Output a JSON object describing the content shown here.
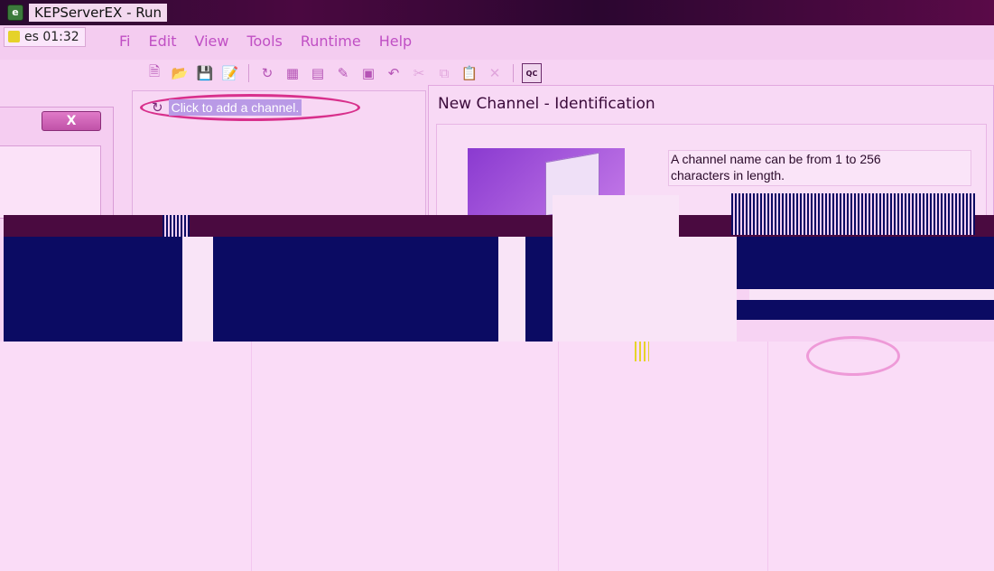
{
  "window": {
    "title": "KEPServerEX - Run",
    "status_time": "es 01:32"
  },
  "menu": {
    "items": [
      {
        "label": "Fi"
      },
      {
        "label": "Edit"
      },
      {
        "label": "View"
      },
      {
        "label": "Tools"
      },
      {
        "label": "Runtime"
      },
      {
        "label": "Help"
      }
    ]
  },
  "toolbar": {
    "buttons": [
      {
        "icon": "new-file-icon"
      },
      {
        "icon": "open-folder-icon"
      },
      {
        "icon": "save-icon"
      },
      {
        "icon": "save-as-icon"
      },
      {
        "icon": "new-channel-icon"
      },
      {
        "icon": "new-device-icon"
      },
      {
        "icon": "new-group-icon"
      },
      {
        "icon": "new-tag-icon"
      },
      {
        "icon": "tag-group-icon"
      },
      {
        "icon": "undo-icon"
      },
      {
        "icon": "cut-icon"
      },
      {
        "icon": "copy-icon"
      },
      {
        "icon": "paste-icon"
      },
      {
        "icon": "delete-icon"
      }
    ],
    "qc_label": "QC"
  },
  "left_panel": {
    "close_label": "X"
  },
  "tree": {
    "add_channel_label": "Click to add a channel."
  },
  "wizard": {
    "title": "New Channel - Identification",
    "help_line1": "A channel name can be from 1 to 256",
    "help_line2": "characters in length."
  }
}
